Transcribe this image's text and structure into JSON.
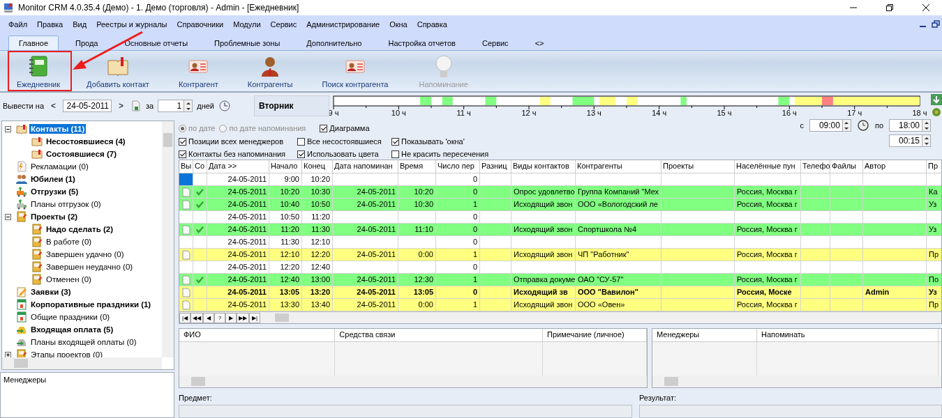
{
  "window": {
    "title": "Monitor CRM 4.0.35.4 (Демо) - 1. Демо (торговля) - Admin - [Ежедневник]"
  },
  "menu": [
    "Файл",
    "Правка",
    "Вид",
    "Реестры и журналы",
    "Справочники",
    "Модули",
    "Сервис",
    "Администрирование",
    "Окна",
    "Справка"
  ],
  "tabs": [
    {
      "label": "Главное",
      "selected": true
    },
    {
      "label": "Прода",
      "selected": false
    },
    {
      "label": "Основные отчеты",
      "selected": false
    },
    {
      "label": "Проблемные зоны",
      "selected": false
    },
    {
      "label": "Дополнительно",
      "selected": false
    },
    {
      "label": "Настройка отчетов",
      "selected": false
    },
    {
      "label": "Сервис",
      "selected": false
    },
    {
      "label": "<>",
      "selected": false
    }
  ],
  "ribbon": [
    {
      "label": "Ежедневник",
      "kind": "diary",
      "disabled": false
    },
    {
      "label": "Добавить контакт",
      "kind": "book",
      "disabled": false
    },
    {
      "label": "Контрагент",
      "kind": "card",
      "disabled": false
    },
    {
      "label": "Контрагенты",
      "kind": "person",
      "disabled": false
    },
    {
      "label": "Поиск контрагента",
      "kind": "card",
      "disabled": false
    },
    {
      "label": "Напоминание",
      "kind": "bulb",
      "disabled": true
    }
  ],
  "date_bar": {
    "label": "Вывести на",
    "prev": "<",
    "date": "24-05-2011",
    "next": ">",
    "days_label_before": "за",
    "days": "1",
    "days_label": "дней"
  },
  "day": {
    "name": "Вторник",
    "hour_labels": [
      "9 ч",
      "10 ч",
      "11 ч",
      "12 ч",
      "13 ч",
      "14 ч",
      "15 ч",
      "16 ч",
      "17 ч",
      "18 ч"
    ]
  },
  "tree": [
    {
      "label": "Контакты (11)",
      "kind": "book",
      "bold": true,
      "selected": true,
      "expanded": true,
      "children": [
        {
          "label": "Несостоявшиеся (4)",
          "kind": "book",
          "bold": true,
          "selected": false
        },
        {
          "label": "Состоявшиеся (7)",
          "kind": "book",
          "bold": true,
          "selected": false
        }
      ]
    },
    {
      "label": "Рекламации (0)",
      "kind": "claim",
      "bold": false,
      "selected": false
    },
    {
      "label": "Юбилеи (1)",
      "kind": "people",
      "bold": true,
      "selected": false
    },
    {
      "label": "Отгрузки (5)",
      "kind": "truck",
      "bold": true,
      "selected": false
    },
    {
      "label": "Планы отгрузок (0)",
      "kind": "truck-grey",
      "bold": false,
      "selected": false
    },
    {
      "label": "Проекты (2)",
      "kind": "folder",
      "bold": true,
      "selected": false,
      "expanded": true,
      "children": [
        {
          "label": "Надо сделать (2)",
          "kind": "folder",
          "bold": true,
          "selected": false
        },
        {
          "label": "В работе (0)",
          "kind": "folder",
          "bold": false,
          "selected": false
        },
        {
          "label": "Завершен удачно (0)",
          "kind": "folder",
          "bold": false,
          "selected": false
        },
        {
          "label": "Завершен неудачно (0)",
          "kind": "folder",
          "bold": false,
          "selected": false
        },
        {
          "label": "Отменен (0)",
          "kind": "folder",
          "bold": false,
          "selected": false
        }
      ]
    },
    {
      "label": "Заявки (3)",
      "kind": "note",
      "bold": true,
      "selected": false
    },
    {
      "label": "Корпоративные праздники (1)",
      "kind": "calendar",
      "bold": true,
      "selected": false
    },
    {
      "label": "Общие праздники (0)",
      "kind": "calendar",
      "bold": false,
      "selected": false
    },
    {
      "label": "Входящая оплата (5)",
      "kind": "money",
      "bold": true,
      "selected": false
    },
    {
      "label": "Планы входящей оплаты (0)",
      "kind": "money-grey",
      "bold": false,
      "selected": false
    },
    {
      "label": "Этапы проектов (0)",
      "kind": "folder",
      "bold": false,
      "selected": false,
      "expanded": false
    }
  ],
  "managers_panel": {
    "title": "Менеджеры"
  },
  "options": {
    "radios": [
      {
        "label": "по дате",
        "selected": true,
        "disabled": true
      },
      {
        "label": "по дате напоминания",
        "selected": false,
        "disabled": true
      }
    ],
    "chart_toggle": {
      "label": "Диаграмма",
      "checked": true
    },
    "checks": [
      {
        "label": "Позиции всех менеджеров",
        "checked": true
      },
      {
        "label": "Все несостоявшиеся",
        "checked": false
      },
      {
        "label": "Показывать 'окна'",
        "checked": true
      },
      {
        "label": "Контакты без напоминания",
        "checked": true
      },
      {
        "label": "Использовать цвета",
        "checked": true
      },
      {
        "label": "Не красить пересечения",
        "checked": false
      }
    ],
    "from_label": "с",
    "from": "09:00",
    "to_label": "по",
    "to": "18:00",
    "step": "00:15"
  },
  "table": {
    "columns": [
      "Вы",
      "Со",
      "Дата >>",
      "Начало",
      "Конец",
      "Дата напоминан",
      "Время",
      "Число пер",
      "Разниц",
      "Виды контактов",
      "Контрагенты",
      "Проекты",
      "Населённые пун",
      "Телефо",
      "Файлы",
      "Автор",
      "Пр"
    ],
    "rows": [
      {
        "color": "#ffffff",
        "bold": false,
        "selected": true,
        "note": false,
        "done": false,
        "cells": [
          "",
          "",
          "24-05-2011",
          "9:00",
          "10:20",
          "",
          "",
          "0",
          "",
          "",
          "",
          "",
          "",
          "",
          "",
          "",
          ""
        ]
      },
      {
        "color": "#80ff80",
        "bold": false,
        "selected": false,
        "note": true,
        "done": true,
        "cells": [
          "",
          "",
          "24-05-2011",
          "10:20",
          "10:30",
          "24-05-2011",
          "10:20",
          "0",
          "",
          "Опрос удовлетво",
          "Группа Компаний \"Мех",
          "",
          "Россия, Москва г",
          "",
          "",
          "",
          "Ка"
        ]
      },
      {
        "color": "#80ff80",
        "bold": false,
        "selected": false,
        "note": true,
        "done": true,
        "cells": [
          "",
          "",
          "24-05-2011",
          "10:40",
          "10:50",
          "24-05-2011",
          "10:30",
          "1",
          "",
          "Исходящий звон",
          "ООО «Вологодский ле",
          "",
          "Россия, Москва г",
          "",
          "",
          "",
          "Уз"
        ]
      },
      {
        "color": "#ffffff",
        "bold": false,
        "selected": false,
        "note": false,
        "done": false,
        "cells": [
          "",
          "",
          "24-05-2011",
          "10:50",
          "11:20",
          "",
          "",
          "0",
          "",
          "",
          "",
          "",
          "",
          "",
          "",
          "",
          ""
        ]
      },
      {
        "color": "#80ff80",
        "bold": false,
        "selected": false,
        "note": true,
        "done": true,
        "cells": [
          "",
          "",
          "24-05-2011",
          "11:20",
          "11:30",
          "24-05-2011",
          "11:10",
          "0",
          "",
          "Исходящий звон",
          "Спортшкола №4",
          "",
          "Россия, Москва г",
          "",
          "",
          "",
          "Уз"
        ]
      },
      {
        "color": "#ffffff",
        "bold": false,
        "selected": false,
        "note": false,
        "done": false,
        "cells": [
          "",
          "",
          "24-05-2011",
          "11:30",
          "12:10",
          "",
          "",
          "0",
          "",
          "",
          "",
          "",
          "",
          "",
          "",
          "",
          ""
        ]
      },
      {
        "color": "#ffff80",
        "bold": false,
        "selected": false,
        "note": true,
        "done": false,
        "cells": [
          "",
          "",
          "24-05-2011",
          "12:10",
          "12:20",
          "24-05-2011",
          "0:00",
          "1",
          "",
          "Исходящий звон",
          "ЧП \"Работник\"",
          "",
          "Россия, Москва г",
          "",
          "",
          "",
          "Пр"
        ]
      },
      {
        "color": "#ffffff",
        "bold": false,
        "selected": false,
        "note": false,
        "done": false,
        "cells": [
          "",
          "",
          "24-05-2011",
          "12:20",
          "12:40",
          "",
          "",
          "0",
          "",
          "",
          "",
          "",
          "",
          "",
          "",
          "",
          ""
        ]
      },
      {
        "color": "#80ff80",
        "bold": false,
        "selected": false,
        "note": true,
        "done": true,
        "cells": [
          "",
          "",
          "24-05-2011",
          "12:40",
          "13:00",
          "24-05-2011",
          "12:30",
          "1",
          "",
          "Отправка докуме",
          "ОАО \"СУ-57\"",
          "",
          "Россия, Москва г",
          "",
          "",
          "",
          "По"
        ]
      },
      {
        "color": "#ffff80",
        "bold": true,
        "selected": false,
        "note": true,
        "done": false,
        "cells": [
          "",
          "",
          "24-05-2011",
          "13:05",
          "13:20",
          "24-05-2011",
          "13:05",
          "0",
          "",
          "Исходящий зв",
          "ООО \"Вавилон\"",
          "",
          "Россия, Моске",
          "",
          "",
          "Admin",
          "Уз"
        ]
      },
      {
        "color": "#ffff80",
        "bold": false,
        "selected": false,
        "note": true,
        "done": false,
        "cells": [
          "",
          "",
          "24-05-2011",
          "13:30",
          "13:40",
          "24-05-2011",
          "0:00",
          "1",
          "",
          "Исходящий звон",
          "ООО «Овен»",
          "",
          "Россия, Москва г",
          "",
          "",
          "",
          "Пр"
        ]
      }
    ],
    "nav": [
      "|◀",
      "◀◀",
      "◀",
      "?",
      "▶",
      "▶▶",
      "▶|"
    ]
  },
  "contacts_grid": {
    "columns": [
      "ФИО",
      "Средства связи",
      "Примечание (личное)"
    ]
  },
  "managers_grid": {
    "columns": [
      "Менеджеры",
      "Напоминать"
    ]
  },
  "subject": {
    "label": "Предмет:"
  },
  "result": {
    "label": "Результат:"
  }
}
